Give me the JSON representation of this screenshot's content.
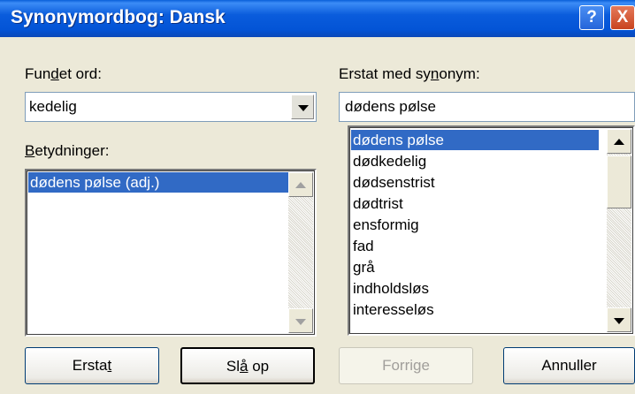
{
  "window": {
    "title": "Synonymordbog: Dansk",
    "help_glyph": "?",
    "close_glyph": "X"
  },
  "found_word": {
    "label_a": "Fun",
    "label_u": "d",
    "label_b": "et ord:",
    "value": "kedelig"
  },
  "meanings": {
    "label_a": "",
    "label_u": "B",
    "label_b": "etydninger:",
    "items": [
      "dødens pølse (adj.)"
    ],
    "selected_index": 0
  },
  "replace": {
    "label_a": "Erstat med sy",
    "label_u": "n",
    "label_b": "onym:",
    "value": "dødens pølse"
  },
  "synonyms": {
    "items": [
      "dødens pølse",
      "dødkedelig",
      "dødsenstrist",
      "dødtrist",
      "ensformig",
      "fad",
      "grå",
      "indholdsløs",
      "interesseløs"
    ],
    "selected_index": 0
  },
  "buttons": {
    "replace": {
      "label_a": "Ersta",
      "label_u": "t",
      "label_b": "",
      "enabled": true
    },
    "lookup": {
      "label_a": "Sl",
      "label_u": "å",
      "label_b": " op",
      "enabled": true,
      "default": true
    },
    "previous": {
      "label": "Forrige",
      "enabled": false
    },
    "cancel": {
      "label": "Annuller",
      "enabled": true
    }
  },
  "colors": {
    "titlebar": "#0a5cdc",
    "selection": "#316ac5",
    "dialog_bg": "#ece9d8"
  }
}
